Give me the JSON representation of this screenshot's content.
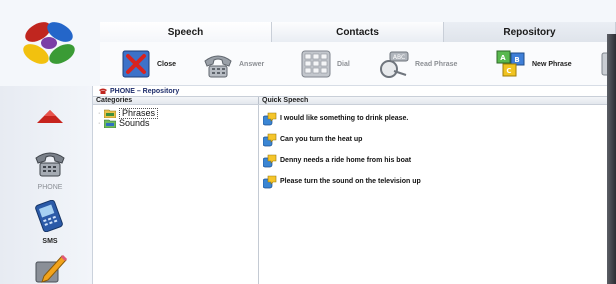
{
  "tabs": [
    {
      "label": "Speech",
      "active": true
    },
    {
      "label": "Contacts",
      "active": false
    },
    {
      "label": "Repository",
      "active": false
    }
  ],
  "toolbar": {
    "close": "Close",
    "answer": "Answer",
    "dial": "Dial",
    "read_phrase": "Read Phrase",
    "new_phrase": "New Phrase"
  },
  "sidebar": {
    "phone": "PHONE",
    "sms": "SMS"
  },
  "breadcrumb": "PHONE – Repository",
  "columns": {
    "categories": "Categories",
    "quick_speech": "Quick Speech"
  },
  "categories": [
    {
      "label": "Phrases",
      "selected": true
    },
    {
      "label": "Sounds",
      "selected": false
    }
  ],
  "phrases": [
    "I would like something to drink please.",
    "Can you turn the heat up",
    "Denny needs a ride home from his boat",
    "Please turn the sound on the television up"
  ],
  "colors": {
    "brand_red": "#c0261f",
    "brand_blue": "#2466c9",
    "brand_yellow": "#f2c10f",
    "brand_green": "#3a9b35",
    "breadcrumb": "#1e2d6b"
  }
}
